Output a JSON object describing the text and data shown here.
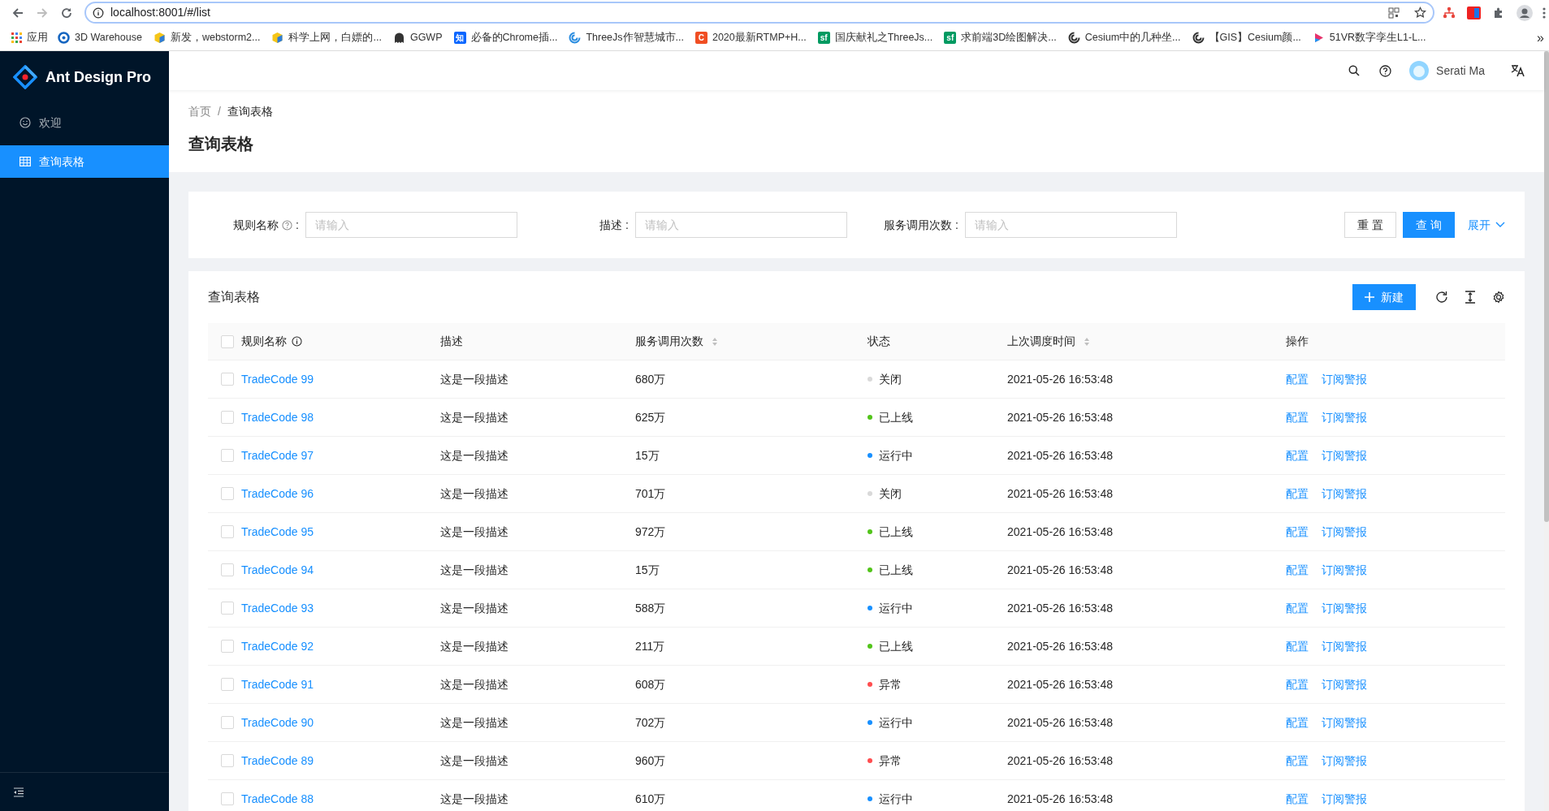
{
  "browser": {
    "url": "localhost:8001/#/list",
    "apps_label": "应用",
    "bookmarks": [
      {
        "label": "3D Warehouse",
        "icon": {
          "kind": "ring",
          "color": "#1565c0"
        }
      },
      {
        "label": "新发，webstorm2...",
        "icon": {
          "kind": "cube",
          "color": "#2e7dd7"
        }
      },
      {
        "label": "科学上网，白嫖的...",
        "icon": {
          "kind": "cube",
          "color": "#2e7dd7"
        }
      },
      {
        "label": "GGWP",
        "icon": {
          "kind": "ghost",
          "color": "#333333"
        }
      },
      {
        "label": "必备的Chrome插...",
        "icon": {
          "kind": "letter",
          "text": "知",
          "color": "#0a66ff"
        }
      },
      {
        "label": "ThreeJs作智慧城市...",
        "icon": {
          "kind": "swirl",
          "color": "#2b8de0"
        }
      },
      {
        "label": "2020最新RTMP+H...",
        "icon": {
          "kind": "letter",
          "text": "C",
          "color": "#f04e23"
        }
      },
      {
        "label": "国庆献礼之ThreeJs...",
        "icon": {
          "kind": "letter",
          "text": "sf",
          "color": "#009a61"
        }
      },
      {
        "label": "求前端3D绘图解决...",
        "icon": {
          "kind": "letter",
          "text": "sf",
          "color": "#009a61"
        }
      },
      {
        "label": "Cesium中的几种坐...",
        "icon": {
          "kind": "swirl",
          "color": "#333333"
        }
      },
      {
        "label": "【GIS】Cesium颜...",
        "icon": {
          "kind": "swirl",
          "color": "#333333"
        }
      },
      {
        "label": "51VR数字孪生L1-L...",
        "icon": {
          "kind": "play",
          "color": "#e6336c"
        }
      }
    ],
    "more": "»"
  },
  "sidebar": {
    "logo": "Ant Design Pro",
    "items": [
      {
        "label": "欢迎",
        "kind": "smile",
        "selected": false
      },
      {
        "label": "查询表格",
        "kind": "table",
        "selected": true
      }
    ]
  },
  "header": {
    "user": "Serati Ma"
  },
  "breadcrumb": [
    "首页",
    "查询表格"
  ],
  "breadcrumb_separator": "/",
  "title": "查询表格",
  "filters": [
    {
      "kind": "help",
      "label": "规则名称",
      "colon": ":",
      "placeholder": "请输入"
    },
    {
      "kind": "plain",
      "label": "描述",
      "colon": ":",
      "placeholder": "请输入"
    },
    {
      "kind": "plain",
      "label": "服务调用次数",
      "colon": ":",
      "placeholder": "请输入"
    }
  ],
  "filter_buttons": {
    "reset": "重 置",
    "search": "查 询",
    "expand": "展开"
  },
  "table": {
    "title": "查询表格",
    "new_button": "新建",
    "select_all_checked": false,
    "columns": [
      {
        "kind": "info",
        "label": "规则名称"
      },
      {
        "kind": "plain",
        "label": "描述"
      },
      {
        "kind": "sortable",
        "label": "服务调用次数"
      },
      {
        "kind": "plain",
        "label": "状态"
      },
      {
        "kind": "sortable",
        "label": "上次调度时间"
      },
      {
        "kind": "plain",
        "label": "操作"
      }
    ],
    "rows": [
      {
        "checked": false,
        "name": "TradeCode 99",
        "desc": "这是一段描述",
        "calls": "680万",
        "status": "关闭",
        "color": "#d9d9d9",
        "time": "2021-05-26 16:53:48",
        "actions": [
          "配置",
          "订阅警报"
        ]
      },
      {
        "checked": false,
        "name": "TradeCode 98",
        "desc": "这是一段描述",
        "calls": "625万",
        "status": "已上线",
        "color": "#52c41a",
        "time": "2021-05-26 16:53:48",
        "actions": [
          "配置",
          "订阅警报"
        ]
      },
      {
        "checked": false,
        "name": "TradeCode 97",
        "desc": "这是一段描述",
        "calls": "15万",
        "status": "运行中",
        "color": "#1890ff",
        "time": "2021-05-26 16:53:48",
        "actions": [
          "配置",
          "订阅警报"
        ]
      },
      {
        "checked": false,
        "name": "TradeCode 96",
        "desc": "这是一段描述",
        "calls": "701万",
        "status": "关闭",
        "color": "#d9d9d9",
        "time": "2021-05-26 16:53:48",
        "actions": [
          "配置",
          "订阅警报"
        ]
      },
      {
        "checked": false,
        "name": "TradeCode 95",
        "desc": "这是一段描述",
        "calls": "972万",
        "status": "已上线",
        "color": "#52c41a",
        "time": "2021-05-26 16:53:48",
        "actions": [
          "配置",
          "订阅警报"
        ]
      },
      {
        "checked": false,
        "name": "TradeCode 94",
        "desc": "这是一段描述",
        "calls": "15万",
        "status": "已上线",
        "color": "#52c41a",
        "time": "2021-05-26 16:53:48",
        "actions": [
          "配置",
          "订阅警报"
        ]
      },
      {
        "checked": false,
        "name": "TradeCode 93",
        "desc": "这是一段描述",
        "calls": "588万",
        "status": "运行中",
        "color": "#1890ff",
        "time": "2021-05-26 16:53:48",
        "actions": [
          "配置",
          "订阅警报"
        ]
      },
      {
        "checked": false,
        "name": "TradeCode 92",
        "desc": "这是一段描述",
        "calls": "211万",
        "status": "已上线",
        "color": "#52c41a",
        "time": "2021-05-26 16:53:48",
        "actions": [
          "配置",
          "订阅警报"
        ]
      },
      {
        "checked": false,
        "name": "TradeCode 91",
        "desc": "这是一段描述",
        "calls": "608万",
        "status": "异常",
        "color": "#ff4d4f",
        "time": "2021-05-26 16:53:48",
        "actions": [
          "配置",
          "订阅警报"
        ]
      },
      {
        "checked": false,
        "name": "TradeCode 90",
        "desc": "这是一段描述",
        "calls": "702万",
        "status": "运行中",
        "color": "#1890ff",
        "time": "2021-05-26 16:53:48",
        "actions": [
          "配置",
          "订阅警报"
        ]
      },
      {
        "checked": false,
        "name": "TradeCode 89",
        "desc": "这是一段描述",
        "calls": "960万",
        "status": "异常",
        "color": "#ff4d4f",
        "time": "2021-05-26 16:53:48",
        "actions": [
          "配置",
          "订阅警报"
        ]
      },
      {
        "checked": false,
        "name": "TradeCode 88",
        "desc": "这是一段描述",
        "calls": "610万",
        "status": "运行中",
        "color": "#1890ff",
        "time": "2021-05-26 16:53:48",
        "actions": [
          "配置",
          "订阅警报"
        ]
      }
    ]
  }
}
